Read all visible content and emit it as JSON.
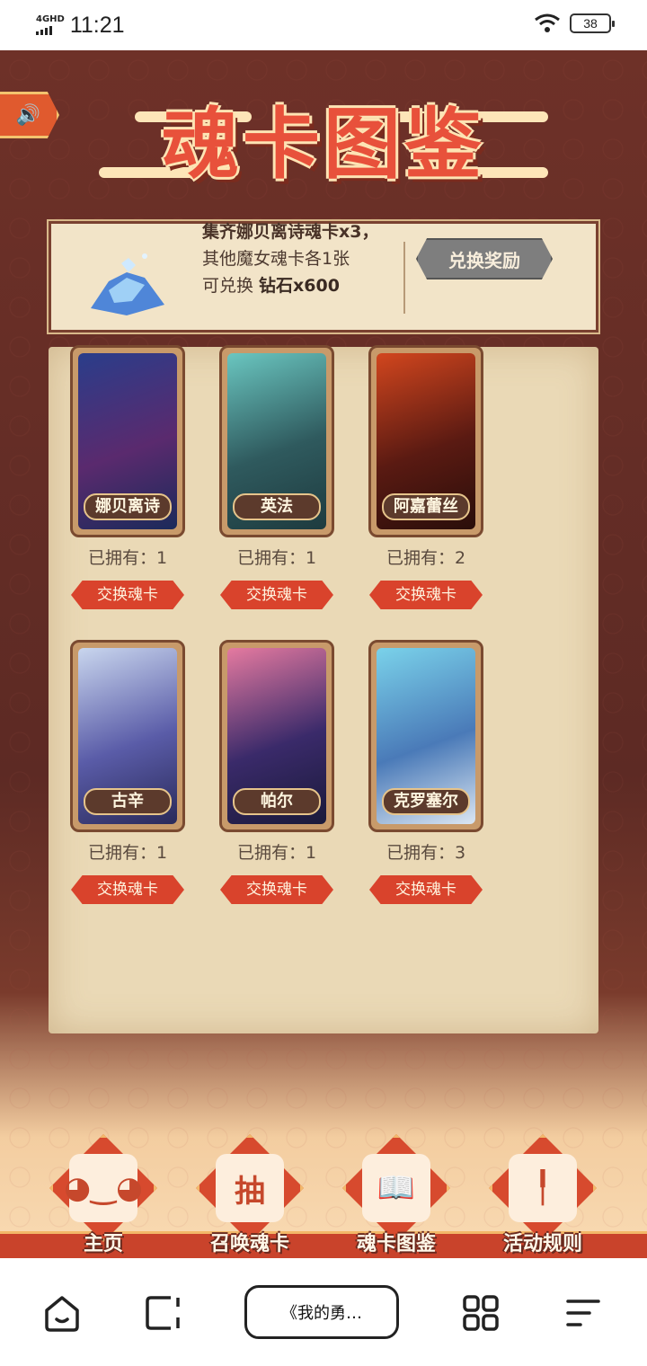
{
  "status_bar": {
    "network": "4GHD",
    "time": "11:21",
    "battery": "38"
  },
  "game": {
    "title": "魂卡图鉴",
    "sound_icon": "speaker-icon",
    "reward": {
      "line1": "集齐娜贝离诗魂卡x3，",
      "line2": "其他魔女魂卡各1张",
      "line3_prefix": "可兑换 ",
      "line3_value": "钻石x600",
      "button": "兑换奖励"
    },
    "cards": [
      {
        "name": "娜贝离诗",
        "owned": "已拥有：1",
        "button": "交换魂卡",
        "colors": [
          "#2a3d8a",
          "#5a2a6e",
          "#1b2a5a"
        ]
      },
      {
        "name": "英法",
        "owned": "已拥有：1",
        "button": "交换魂卡",
        "colors": [
          "#6ac6c0",
          "#2f5a5e",
          "#1e3b3f"
        ]
      },
      {
        "name": "阿嘉蕾丝",
        "owned": "已拥有：2",
        "button": "交换魂卡",
        "colors": [
          "#d2461e",
          "#5a1a12",
          "#2a0e0a"
        ]
      },
      {
        "name": "古辛",
        "owned": "已拥有：1",
        "button": "交换魂卡",
        "colors": [
          "#c9d6ee",
          "#5a5ca8",
          "#2a2a5a"
        ]
      },
      {
        "name": "帕尔",
        "owned": "已拥有：1",
        "button": "交换魂卡",
        "colors": [
          "#e57aa0",
          "#3a2a6a",
          "#1a1a3a"
        ]
      },
      {
        "name": "克罗塞尔",
        "owned": "已拥有：3",
        "button": "交换魂卡",
        "colors": [
          "#7ad2ea",
          "#4a7ab8",
          "#dbe6f2"
        ]
      }
    ],
    "nav": [
      {
        "label": "主页",
        "icon": "bunny-icon"
      },
      {
        "label": "召唤魂卡",
        "icon": "draw-icon",
        "glyph": "抽"
      },
      {
        "label": "魂卡图鉴",
        "icon": "book-icon"
      },
      {
        "label": "活动规则",
        "icon": "scroll-icon"
      }
    ]
  },
  "browser_bar": {
    "url_title": "《我的勇…",
    "icons": [
      "home-icon",
      "tabs-icon",
      "apps-icon",
      "menu-icon"
    ]
  }
}
